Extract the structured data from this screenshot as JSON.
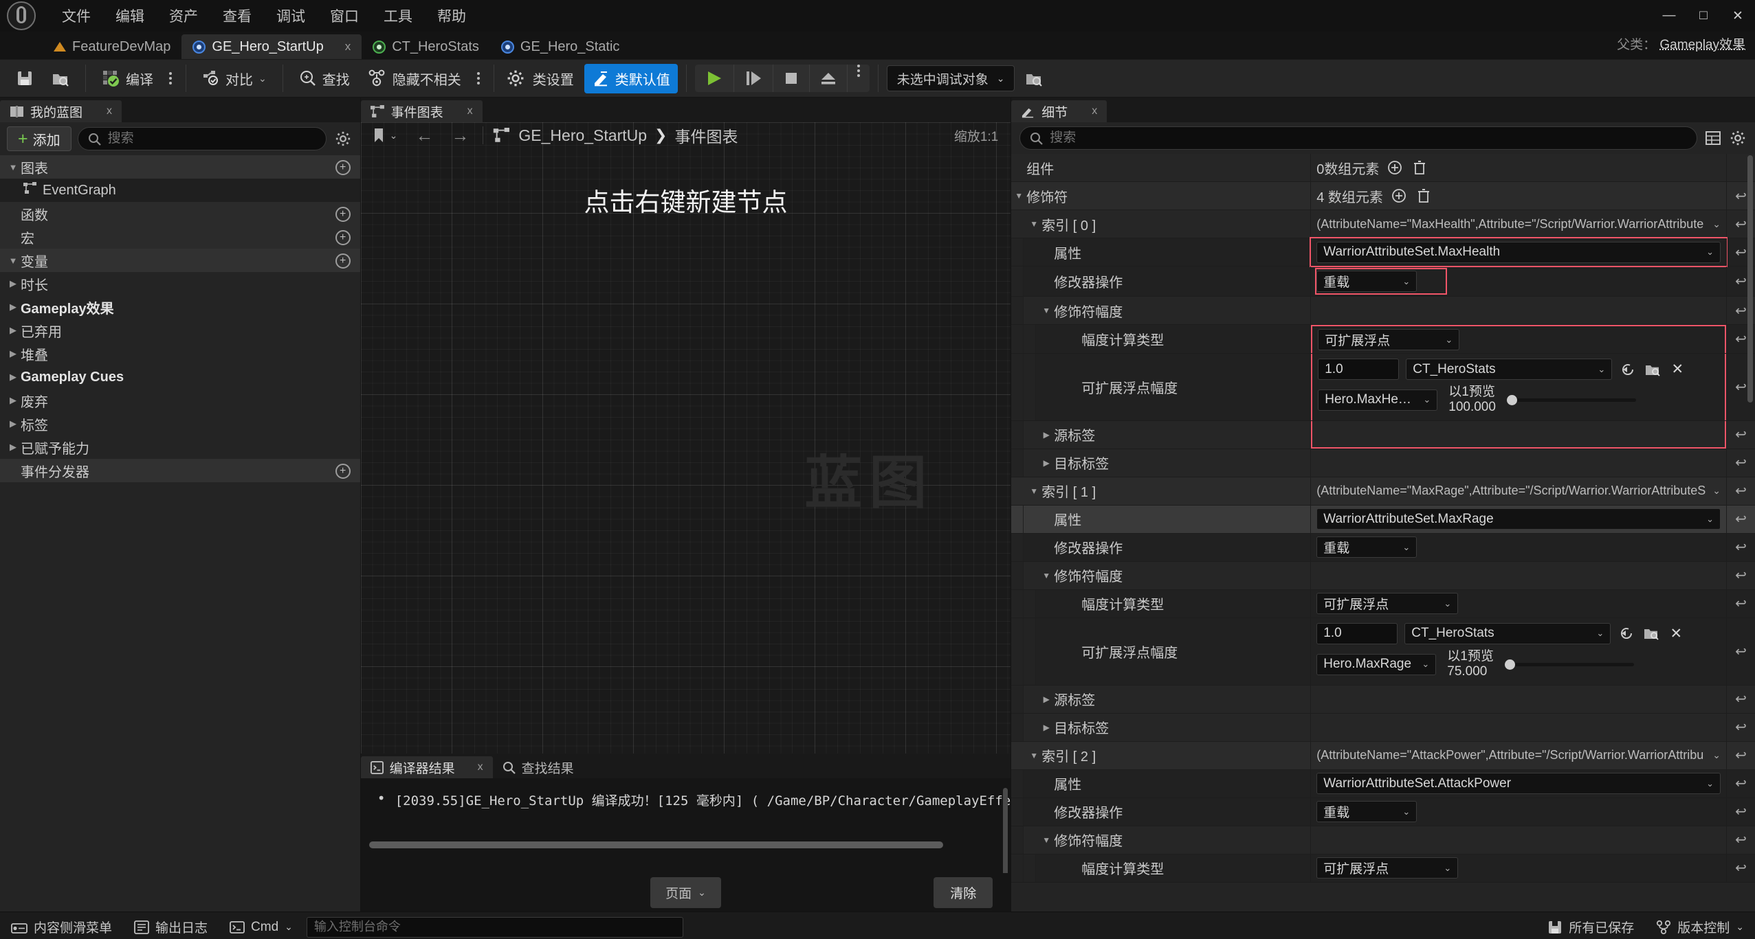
{
  "window": {
    "menu": [
      "文件",
      "编辑",
      "资产",
      "查看",
      "调试",
      "窗口",
      "工具",
      "帮助"
    ],
    "minimize": "—",
    "maximize": "□",
    "close": "✕"
  },
  "asset_tabs": [
    {
      "label": "FeatureDevMap",
      "icon": "map-icon",
      "selected": false
    },
    {
      "label": "GE_Hero_StartUp",
      "icon": "gameplay-effect-icon",
      "selected": true,
      "close": "x"
    },
    {
      "label": "CT_HeroStats",
      "icon": "curve-table-icon",
      "selected": false
    },
    {
      "label": "GE_Hero_Static",
      "icon": "gameplay-effect-icon",
      "selected": false
    }
  ],
  "parent_class": {
    "label": "父类：",
    "value": "Gameplay效果"
  },
  "toolbar": {
    "save_icon": "save-icon",
    "browse_icon": "browse-content-icon",
    "compile_label": "编译",
    "diff_label": "对比",
    "find_label": "查找",
    "hide_unrelated_label": "隐藏不相关",
    "class_settings_label": "类设置",
    "class_defaults_label": "类默认值",
    "debug_object_label": "未选中调试对象",
    "accent": "#0e7ad6"
  },
  "left_panel": {
    "tab": "我的蓝图",
    "tab_close": "x",
    "add_label": "添加",
    "search_placeholder": "搜索",
    "rows": [
      {
        "label": "图表",
        "type": "header",
        "expanded": true,
        "add": true
      },
      {
        "label": "EventGraph",
        "type": "item-graph",
        "selected": true
      },
      {
        "label": "函数",
        "type": "header-plain",
        "add": true
      },
      {
        "label": "宏",
        "type": "header-plain",
        "add": true
      },
      {
        "label": "变量",
        "type": "header",
        "expanded": true,
        "add": true
      },
      {
        "label": "时长",
        "type": "category"
      },
      {
        "label": "Gameplay效果",
        "type": "category",
        "bold": true
      },
      {
        "label": "已弃用",
        "type": "category"
      },
      {
        "label": "堆叠",
        "type": "category"
      },
      {
        "label": "Gameplay Cues",
        "type": "category",
        "bold": true
      },
      {
        "label": "废弃",
        "type": "category"
      },
      {
        "label": "标签",
        "type": "category"
      },
      {
        "label": "已赋予能力",
        "type": "category"
      },
      {
        "label": "事件分发器",
        "type": "header-plain",
        "add": true
      }
    ]
  },
  "center_panel": {
    "tab": "事件图表",
    "tab_close": "x",
    "breadcrumb": [
      "GE_Hero_StartUp",
      "事件图表"
    ],
    "breadcrumb_sep": "❯",
    "zoom_label": "缩放1:1",
    "graph_hint": "点击右键新建节点",
    "watermark": "蓝图",
    "back_arrow": "←",
    "forward_arrow": "→"
  },
  "compiler_panel": {
    "tabs": [
      {
        "label": "编译器结果",
        "selected": true,
        "close": "x",
        "icon": "compiler-icon"
      },
      {
        "label": "查找结果",
        "selected": false,
        "icon": "search-icon"
      }
    ],
    "log_bullet": "•",
    "log_line": "[2039.55]GE_Hero_StartUp 编译成功！[125 毫秒内] ( /Game/BP/Character/GameplayEffe",
    "page_label": "页面",
    "clear_label": "清除"
  },
  "details_panel": {
    "tab": "细节",
    "tab_close": "x",
    "search_placeholder": "搜索",
    "grid_icon": "column-layout-icon",
    "settings_icon": "gear-icon",
    "reset_icon": "↩",
    "rows": [
      {
        "indent": 0,
        "label": "组件",
        "kind": "array",
        "value": "0数组元素",
        "reset": false
      },
      {
        "indent": 0,
        "label": "修饰符",
        "kind": "array",
        "value": "4 数组元素",
        "caret": "down",
        "reset": true
      },
      {
        "indent": 1,
        "label": "索引 [ 0 ]",
        "kind": "struct",
        "caret": "down",
        "value": "(AttributeName=\"MaxHealth\",Attribute=\"/Script/Warrior.WarriorAttribute",
        "reset": true
      },
      {
        "indent": 2,
        "label": "属性",
        "kind": "combo-wide",
        "value": "WarriorAttributeSet.MaxHealth",
        "highlight": true,
        "reset": true
      },
      {
        "indent": 2,
        "label": "修改器操作",
        "kind": "combo-small",
        "value": "重载",
        "highlight": true,
        "reset": true
      },
      {
        "indent": 2,
        "label": "修饰符幅度",
        "kind": "group",
        "caret": "down",
        "reset": true
      },
      {
        "indent": 3,
        "label": "幅度计算类型",
        "kind": "combo-mid",
        "value": "可扩展浮点",
        "highlight": true,
        "reset": true
      },
      {
        "indent": 3,
        "label": "可扩展浮点幅度",
        "kind": "scalable-float",
        "coefficient": "1.0",
        "curve_table": "CT_HeroStats",
        "curve_row": "Hero.MaxHealth",
        "preview_label": "以1预览",
        "preview_value": "100.000",
        "highlight": true,
        "reset": true
      },
      {
        "indent": 2,
        "label": "源标签",
        "kind": "group",
        "caret": "right",
        "highlight": true,
        "reset": true
      },
      {
        "indent": 2,
        "label": "目标标签",
        "kind": "group",
        "caret": "right",
        "reset": true
      },
      {
        "indent": 1,
        "label": "索引 [ 1 ]",
        "kind": "struct",
        "caret": "down",
        "value": "(AttributeName=\"MaxRage\",Attribute=\"/Script/Warrior.WarriorAttributeS",
        "reset": true
      },
      {
        "indent": 2,
        "label": "属性",
        "kind": "combo-wide",
        "value": "WarriorAttributeSet.MaxRage",
        "selected": true,
        "reset": true
      },
      {
        "indent": 2,
        "label": "修改器操作",
        "kind": "combo-small",
        "value": "重载",
        "reset": true
      },
      {
        "indent": 2,
        "label": "修饰符幅度",
        "kind": "group",
        "caret": "down",
        "reset": true
      },
      {
        "indent": 3,
        "label": "幅度计算类型",
        "kind": "combo-mid",
        "value": "可扩展浮点",
        "reset": true
      },
      {
        "indent": 3,
        "label": "可扩展浮点幅度",
        "kind": "scalable-float",
        "coefficient": "1.0",
        "curve_table": "CT_HeroStats",
        "curve_row": "Hero.MaxRage",
        "preview_label": "以1预览",
        "preview_value": "75.000",
        "reset": true
      },
      {
        "indent": 2,
        "label": "源标签",
        "kind": "group",
        "caret": "right",
        "reset": true
      },
      {
        "indent": 2,
        "label": "目标标签",
        "kind": "group",
        "caret": "right",
        "reset": true
      },
      {
        "indent": 1,
        "label": "索引 [ 2 ]",
        "kind": "struct",
        "caret": "down",
        "value": "(AttributeName=\"AttackPower\",Attribute=\"/Script/Warrior.WarriorAttribu",
        "reset": true
      },
      {
        "indent": 2,
        "label": "属性",
        "kind": "combo-wide",
        "value": "WarriorAttributeSet.AttackPower",
        "reset": true
      },
      {
        "indent": 2,
        "label": "修改器操作",
        "kind": "combo-small",
        "value": "重载",
        "reset": true
      },
      {
        "indent": 2,
        "label": "修饰符幅度",
        "kind": "group",
        "caret": "down",
        "reset": true
      },
      {
        "indent": 3,
        "label": "幅度计算类型",
        "kind": "combo-mid",
        "value": "可扩展浮点",
        "reset": true
      }
    ]
  },
  "status_bar": {
    "drawer_label": "内容侧滑菜单",
    "output_log_label": "输出日志",
    "cmd_label": "Cmd",
    "cmd_placeholder": "输入控制台命令",
    "saved_label": "所有已保存",
    "revision_label": "版本控制"
  }
}
